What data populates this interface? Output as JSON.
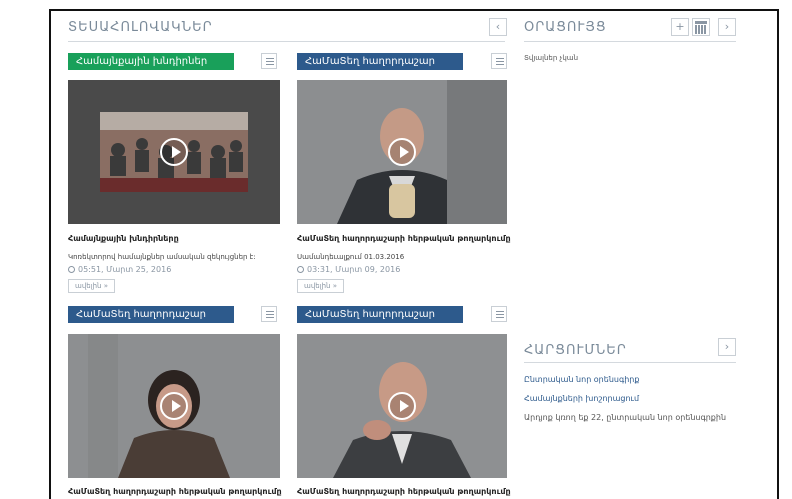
{
  "videos_section": {
    "title": "ՏԵՍԱՀՈԼՈՎԱԿՆԵՐ",
    "prev_label": "‹"
  },
  "calendar_section": {
    "title": "ՕՐԱՑՈՒՅՑ",
    "add_label": "+",
    "next_label": "›",
    "item": "Տվյալներ չկան"
  },
  "series_section": {
    "title": "ՀԱՐՑՈՒՄՆԵՐ",
    "next_label": "›",
    "links": [
      "Ընտրական նոր օրենսգիրք",
      "Համայնքների խոշորացում"
    ],
    "note": "Արդյոք կռող եք 22, ընտրական նոր օրենսգրքին"
  },
  "cards": [
    {
      "category": "Համայնքային խնդիրներ",
      "title": "Համայնքային խնդիրները",
      "desc": "Կոռեկտորով համայնքներ ամսական զեկույցներ է:",
      "date": "05:51, Մարտ 25, 2016",
      "more": "ավելին »"
    },
    {
      "category": "ՀաՄաՏեղ հաղորդաշար",
      "title": "ՀաՄաՏեղ հաղորդաշարի հերթական թողարկումը",
      "desc": "Սամանդեւալքում 01.03.2016",
      "date": "03:31, Մարտ 09, 2016",
      "more": "ավելին »"
    },
    {
      "category": "ՀաՄաՏեղ հաղորդաշար",
      "title": "ՀաՄաՏեղ հաղորդաշարի հերթական թողարկումը"
    },
    {
      "category": "ՀաՄաՏեղ հաղորդաշար",
      "title": "ՀաՄաՏեղ հաղորդաշարի հերթական թողարկումը"
    }
  ],
  "colors": {
    "green_category": "#19a05a",
    "blue_category": "#2d5a8c",
    "link": "#2d5a8c"
  }
}
